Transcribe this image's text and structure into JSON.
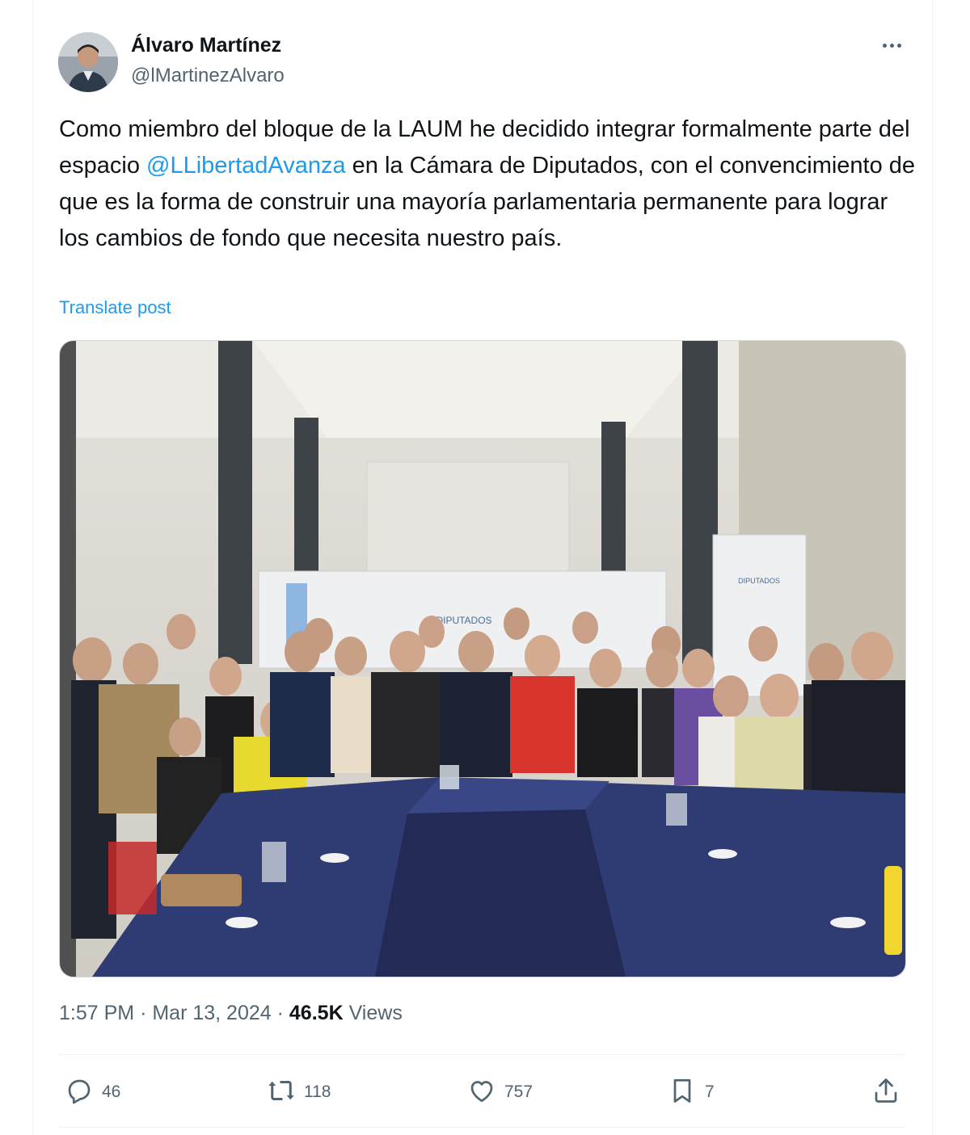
{
  "author": {
    "name": "Álvaro Martínez",
    "handle": "@lMartinezAlvaro"
  },
  "tweet": {
    "text_before": "Como miembro del bloque de la LAUM he decidido integrar formalmente parte del espacio ",
    "mention": "@LLibertadAvanza",
    "text_after": " en la Cámara de Diputados, con el convencimiento de que es la forma de construir una mayoría parlamentaria permanente para lograr los cambios de fondo que necesita nuestro país.",
    "translate_label": "Translate post"
  },
  "photo": {
    "backdrop_text": "DIPUTADOS",
    "side_banner_text": "DIPUTADOS"
  },
  "meta": {
    "time": "1:57 PM",
    "separator": "·",
    "date": "Mar 13, 2024",
    "views_count": "46.5K",
    "views_label": "Views"
  },
  "actions": {
    "replies": "46",
    "reposts": "118",
    "likes": "757",
    "bookmarks": "7"
  },
  "colors": {
    "accent": "#1d9bf0",
    "text": "#0f1419",
    "secondary": "#536471",
    "table": "#2f3b73"
  },
  "icons": [
    "more-icon",
    "reply-icon",
    "repost-icon",
    "like-icon",
    "bookmark-icon",
    "share-icon"
  ]
}
